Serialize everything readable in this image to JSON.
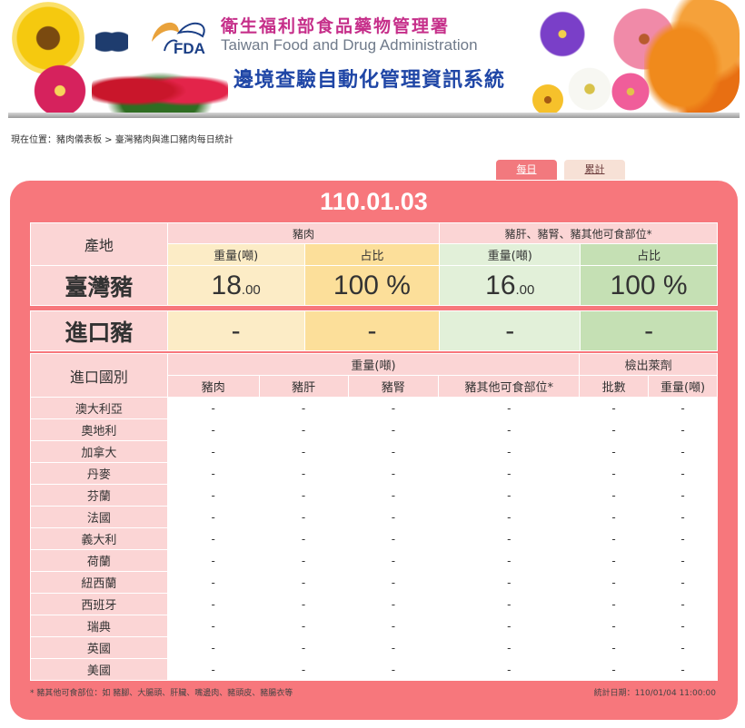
{
  "header": {
    "agency_zh": "衛生福利部食品藥物管理署",
    "fda_mark": "FDA",
    "agency_en": "Taiwan Food and Drug Administration",
    "system_title": "邊境查驗自動化管理資訊系統"
  },
  "breadcrumb": "現在位置：豬肉儀表板 > 臺灣豬肉與進口豬肉每日統計",
  "tabs": [
    {
      "label": "每日"
    },
    {
      "label": "累計"
    }
  ],
  "date": "110.01.03",
  "summary": {
    "origin_label": "產地",
    "group_pork": "豬肉",
    "group_offal": "豬肝、豬腎、豬其他可食部位*",
    "col_weight": "重量(噸)",
    "col_share": "占比",
    "taiwan": {
      "label": "臺灣豬",
      "pork_weight": "18",
      "pork_weight_decimals": ".00",
      "pork_share": "100 %",
      "offal_weight": "16",
      "offal_weight_decimals": ".00",
      "offal_share": "100 %"
    },
    "imported": {
      "label": "進口豬",
      "pork_weight": "-",
      "pork_share": "-",
      "offal_weight": "-",
      "offal_share": "-"
    }
  },
  "imports": {
    "country_label": "進口國別",
    "weight_group": "重量(噸)",
    "drug_group": "檢出萊劑",
    "columns": [
      "豬肉",
      "豬肝",
      "豬腎",
      "豬其他可食部位*",
      "批數",
      "重量(噸)"
    ],
    "rows": [
      {
        "country": "澳大利亞",
        "values": [
          "-",
          "-",
          "-",
          "-",
          "-",
          "-"
        ]
      },
      {
        "country": "奧地利",
        "values": [
          "-",
          "-",
          "-",
          "-",
          "-",
          "-"
        ]
      },
      {
        "country": "加拿大",
        "values": [
          "-",
          "-",
          "-",
          "-",
          "-",
          "-"
        ]
      },
      {
        "country": "丹麥",
        "values": [
          "-",
          "-",
          "-",
          "-",
          "-",
          "-"
        ]
      },
      {
        "country": "芬蘭",
        "values": [
          "-",
          "-",
          "-",
          "-",
          "-",
          "-"
        ]
      },
      {
        "country": "法國",
        "values": [
          "-",
          "-",
          "-",
          "-",
          "-",
          "-"
        ]
      },
      {
        "country": "義大利",
        "values": [
          "-",
          "-",
          "-",
          "-",
          "-",
          "-"
        ]
      },
      {
        "country": "荷蘭",
        "values": [
          "-",
          "-",
          "-",
          "-",
          "-",
          "-"
        ]
      },
      {
        "country": "紐西蘭",
        "values": [
          "-",
          "-",
          "-",
          "-",
          "-",
          "-"
        ]
      },
      {
        "country": "西班牙",
        "values": [
          "-",
          "-",
          "-",
          "-",
          "-",
          "-"
        ]
      },
      {
        "country": "瑞典",
        "values": [
          "-",
          "-",
          "-",
          "-",
          "-",
          "-"
        ]
      },
      {
        "country": "英國",
        "values": [
          "-",
          "-",
          "-",
          "-",
          "-",
          "-"
        ]
      },
      {
        "country": "美國",
        "values": [
          "-",
          "-",
          "-",
          "-",
          "-",
          "-"
        ]
      }
    ]
  },
  "footnote": "* 豬其他可食部位：如 豬腳、大腸頭、肝臟、嘴邊肉、豬頭皮、豬腸衣等",
  "stat_date": "統計日期：110/01/04 11:00:00",
  "colors": {
    "panel": "#f7777c",
    "header_pink": "#fbd5d5",
    "pork_weight_bg": "#fcecc6",
    "pork_share_bg": "#fcdf9a",
    "offal_weight_bg": "#e2f0d9",
    "offal_share_bg": "#c5e0b4"
  }
}
